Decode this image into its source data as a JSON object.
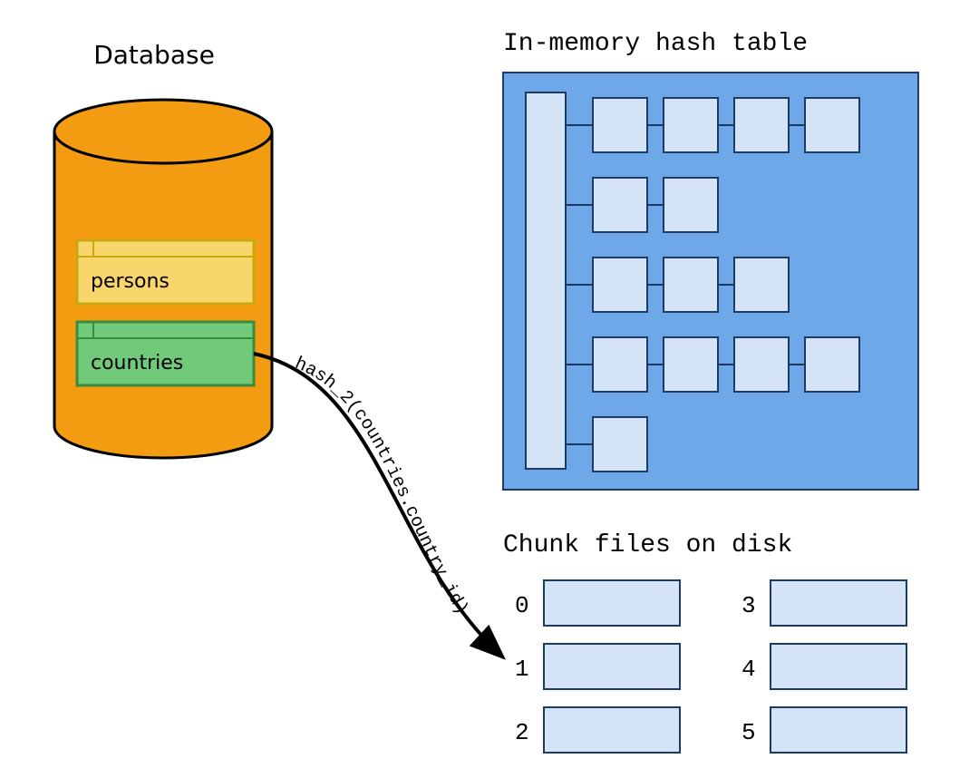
{
  "database": {
    "title": "Database",
    "tables": [
      "persons",
      "countries"
    ]
  },
  "hash_table": {
    "title": "In-memory hash table",
    "bucket_chain_lengths": [
      4,
      2,
      3,
      4,
      1
    ]
  },
  "chunk_files": {
    "title": "Chunk files on disk",
    "labels": [
      "0",
      "1",
      "2",
      "3",
      "4",
      "5"
    ]
  },
  "arrow": {
    "label": "hash_2(countries.country_id)"
  },
  "colors": {
    "cylinder_fill": "#f39c12",
    "cylinder_stroke": "#000000",
    "table_persons_fill": "#f9d66b",
    "table_persons_stroke": "#c9a80f",
    "table_countries_fill": "#71c97a",
    "table_countries_stroke": "#3a8a3f",
    "hash_panel_fill": "#6fa8e8",
    "hash_panel_stroke": "#1c3a66",
    "box_fill": "#d4e3f6",
    "box_stroke": "#1c3a66"
  }
}
